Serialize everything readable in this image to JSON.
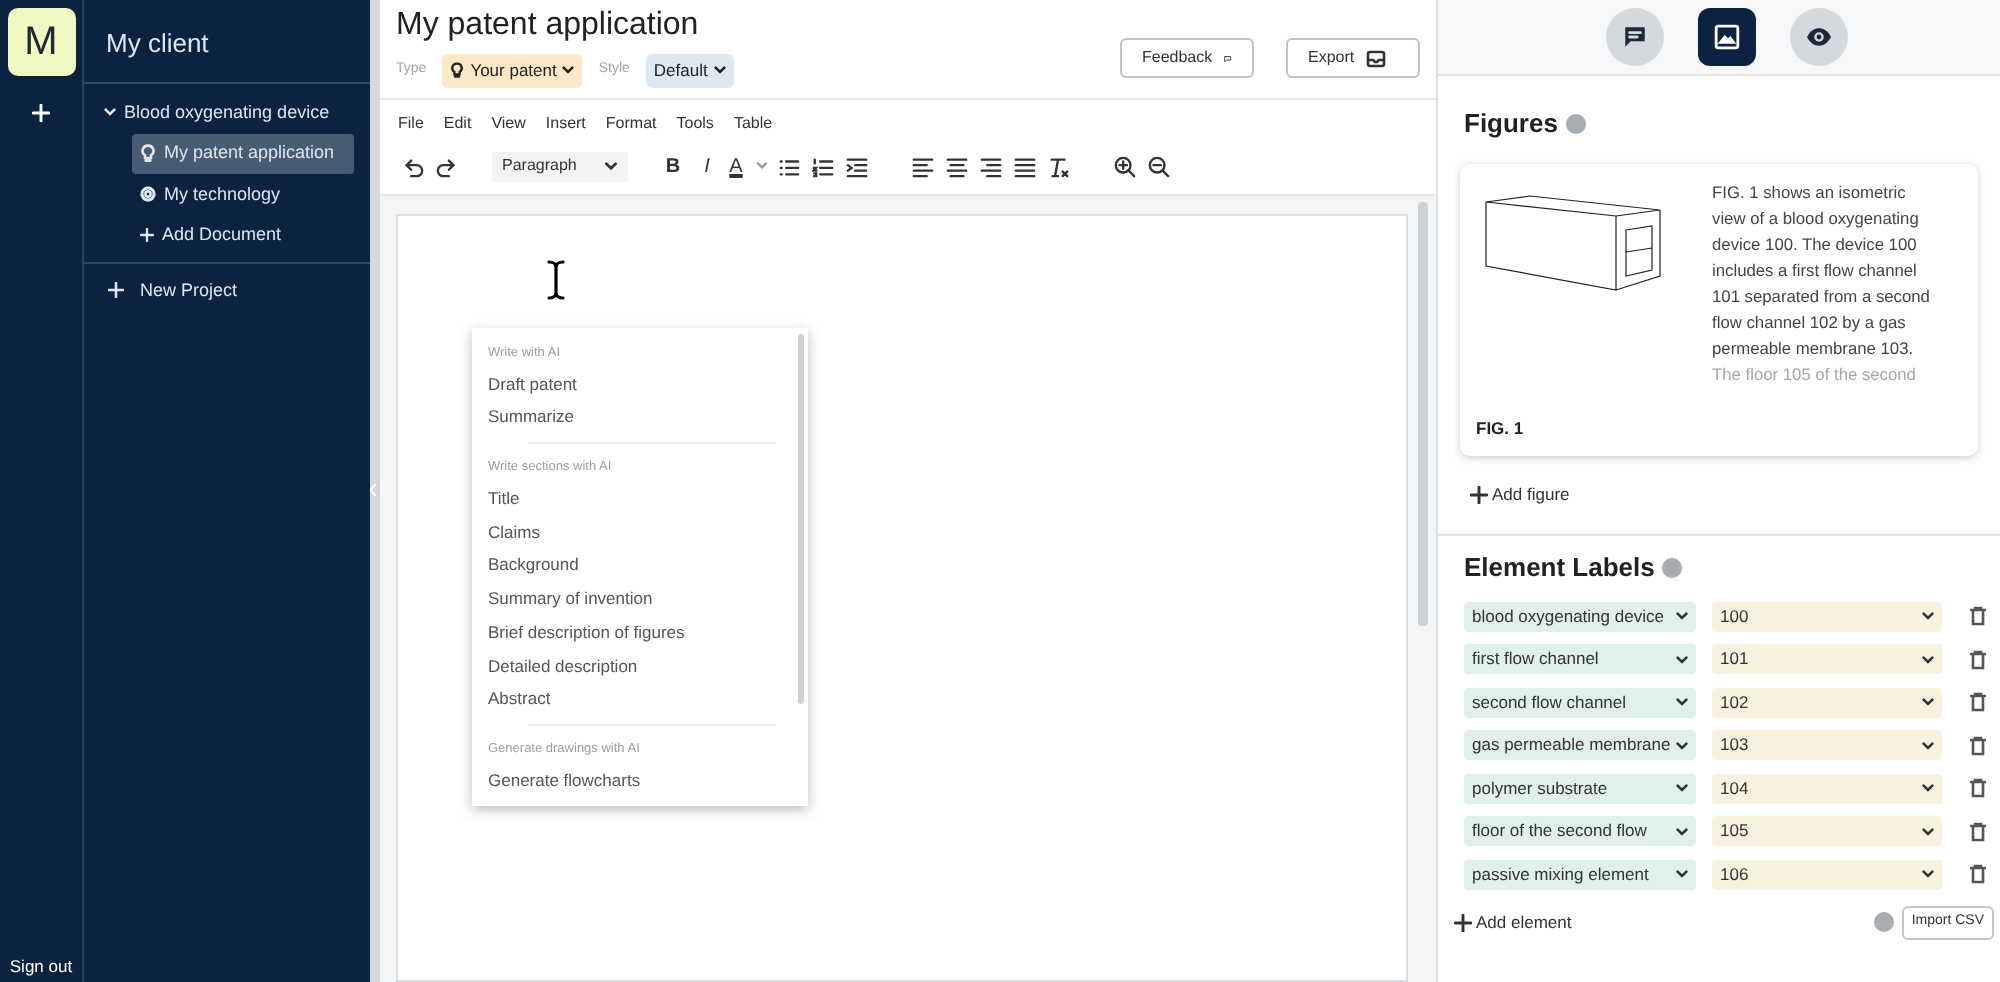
{
  "rail": {
    "avatar": "M",
    "sign_out": "Sign out"
  },
  "tree": {
    "title": "My client",
    "projects": [
      {
        "label": "Blood oxygenating device",
        "expanded": true,
        "children": [
          {
            "label": "My patent application",
            "kind": "patent",
            "selected": true
          },
          {
            "label": "My technology",
            "kind": "technology",
            "selected": false
          },
          {
            "label": "Add Document",
            "kind": "add",
            "selected": false
          }
        ]
      }
    ],
    "new_project": "New Project"
  },
  "header": {
    "title": "My patent application",
    "type_label": "Type",
    "type_value": "Your patent",
    "style_label": "Style",
    "style_value": "Default",
    "buttons": [
      {
        "label": "Feedback",
        "kind": "feedback"
      },
      {
        "label": "Export",
        "kind": "export"
      }
    ]
  },
  "editor": {
    "menu": [
      "File",
      "Edit",
      "View",
      "Insert",
      "Format",
      "Tools",
      "Table"
    ],
    "block_format": "Paragraph",
    "toolbar": [
      {
        "kind": "undo"
      },
      {
        "kind": "redo"
      },
      {
        "kind": "format"
      },
      {
        "kind": "bold",
        "label": "B"
      },
      {
        "kind": "italic",
        "label": "I"
      },
      {
        "kind": "color",
        "label": "A"
      },
      {
        "kind": "bullets"
      },
      {
        "kind": "numbers"
      },
      {
        "kind": "indent"
      },
      {
        "kind": "align-left"
      },
      {
        "kind": "align-center"
      },
      {
        "kind": "align-right"
      },
      {
        "kind": "justify"
      },
      {
        "kind": "clear"
      },
      {
        "kind": "zoom-in"
      },
      {
        "kind": "zoom-out"
      }
    ]
  },
  "ai_menu": {
    "sections": [
      {
        "heading": "Write with AI",
        "items": [
          "Draft patent",
          "Summarize"
        ]
      },
      {
        "heading": "Write sections with AI",
        "items": [
          "Title",
          "Claims",
          "Background",
          "Summary of invention",
          "Brief description of figures",
          "Detailed description",
          "Abstract"
        ]
      },
      {
        "heading": "Generate drawings with AI",
        "items": [
          "Generate flowcharts"
        ]
      }
    ]
  },
  "view_toggles": [
    {
      "kind": "comments",
      "selected": false
    },
    {
      "kind": "figures",
      "selected": true
    },
    {
      "kind": "preview",
      "selected": false
    }
  ],
  "figures": {
    "title": "Figures",
    "items": [
      {
        "caption": "FIG. 1",
        "description": "FIG. 1 shows an isometric view of a blood oxygenating device 100. The device 100 includes a first flow channel 101 separated from a second flow channel 102 by a gas permeable membrane 103.",
        "faded_line": "The floor 105 of the second"
      }
    ],
    "add": "Add figure"
  },
  "element_labels": {
    "title": "Element Labels",
    "rows": [
      {
        "name": "blood oxygenating device",
        "number": "100"
      },
      {
        "name": "first flow channel",
        "number": "101"
      },
      {
        "name": "second flow channel",
        "number": "102"
      },
      {
        "name": "gas permeable membrane",
        "number": "103"
      },
      {
        "name": "polymer substrate",
        "number": "104"
      },
      {
        "name": "floor of the second flow",
        "number": "105"
      },
      {
        "name": "passive mixing element",
        "number": "106"
      }
    ],
    "add": "Add element",
    "import": "Import CSV"
  }
}
